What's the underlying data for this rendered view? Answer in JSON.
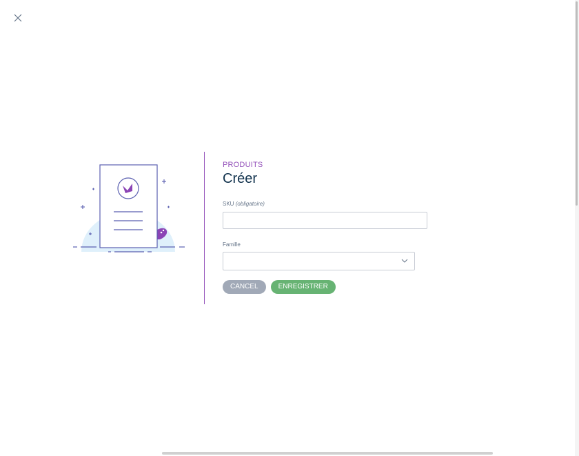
{
  "breadcrumb": "PRODUITS",
  "title": "Créer",
  "fields": {
    "sku": {
      "label": "SKU",
      "hint": "(obligatoire)",
      "value": "",
      "placeholder": ""
    },
    "famille": {
      "label": "Famille",
      "selected": ""
    }
  },
  "buttons": {
    "cancel": "CANCEL",
    "save": "ENREGISTRER"
  },
  "icons": {
    "close": "close-icon",
    "chevron": "chevron-down-icon",
    "illustration": "product-document-illustration"
  },
  "colors": {
    "accent": "#9452ba",
    "title": "#11324d",
    "cancel_button": "#a1a9b7",
    "save_button": "#67b373"
  }
}
